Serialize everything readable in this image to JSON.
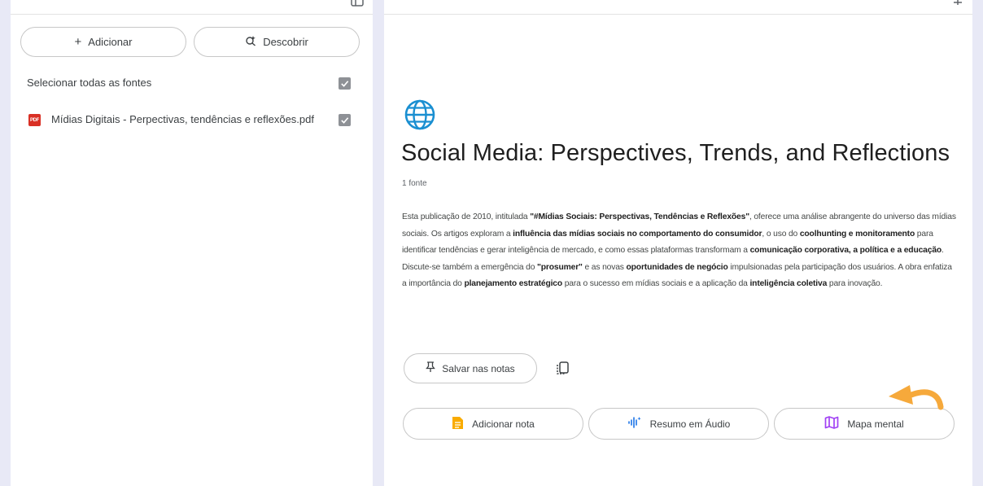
{
  "left_panel": {
    "add_label": "Adicionar",
    "discover_label": "Descobrir",
    "select_all_label": "Selecionar todas as fontes",
    "sources": [
      {
        "type_badge": "PDF",
        "name": "Mídias Digitais - Perpectivas, tendências e reflexões.pdf",
        "checked": true
      }
    ]
  },
  "notebook": {
    "title": "Social Media: Perspectives, Trends, and Reflections",
    "source_count": "1 fonte",
    "summary": [
      {
        "t": "Esta publicação de 2010, intitulada ",
        "b": false
      },
      {
        "t": "\"#Mídias Sociais: Perspectivas, Tendências e Reflexões\"",
        "b": true
      },
      {
        "t": ", oferece uma análise abrangente do universo das mídias sociais. Os artigos exploram a ",
        "b": false
      },
      {
        "t": "influência das mídias sociais no comportamento do consumidor",
        "b": true
      },
      {
        "t": ", o uso do ",
        "b": false
      },
      {
        "t": "coolhunting e monitoramento",
        "b": true
      },
      {
        "t": " para identificar tendências e gerar inteligência de mercado, e como essas plataformas transformam a ",
        "b": false
      },
      {
        "t": "comunicação corporativa, a política e a educação",
        "b": true
      },
      {
        "t": ". Discute-se também a emergência do ",
        "b": false
      },
      {
        "t": "\"prosumer\"",
        "b": true
      },
      {
        "t": " e as novas ",
        "b": false
      },
      {
        "t": "oportunidades de negócio",
        "b": true
      },
      {
        "t": " impulsionadas pela participação dos usuários. A obra enfatiza a importância do ",
        "b": false
      },
      {
        "t": "planejamento estratégico",
        "b": true
      },
      {
        "t": " para o sucesso em mídias sociais e a aplicação da ",
        "b": false
      },
      {
        "t": "inteligência coletiva",
        "b": true
      },
      {
        "t": " para inovação.",
        "b": false
      }
    ],
    "save_notes_label": "Salvar nas notas",
    "actions": {
      "add_note": "Adicionar nota",
      "audio_overview": "Resumo em Áudio",
      "mind_map": "Mapa mental"
    }
  },
  "colors": {
    "background": "#e8e9f6",
    "pdf_badge": "#d93025",
    "note_icon": "#f9ab00",
    "audio_icon": "#1a73e8",
    "mindmap_icon": "#a142f4",
    "globe": "#1a8fd1",
    "arrow": "#f6a93b"
  },
  "icons": {
    "add": "plus-icon",
    "discover": "sparkle-search-icon",
    "pin": "pin-icon",
    "copy": "copy-icon",
    "note": "note-icon",
    "audio": "audio-wave-icon",
    "mind_map": "mind-map-icon",
    "globe": "globe-icon"
  }
}
